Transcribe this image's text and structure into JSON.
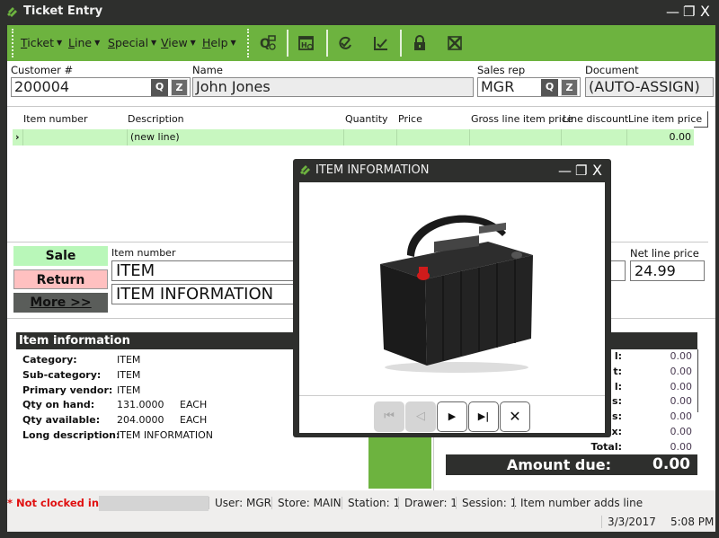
{
  "window": {
    "title": "Ticket Entry",
    "controls": {
      "minimize": "—",
      "restore": "❐",
      "close": "X"
    }
  },
  "menubar": {
    "items": [
      {
        "label": "Ticket",
        "accel": "T",
        "rest": "icket"
      },
      {
        "label": "Line",
        "accel": "L",
        "rest": "ine"
      },
      {
        "label": "Special",
        "accel": "S",
        "rest": "pecial"
      },
      {
        "label": "View",
        "accel": "V",
        "rest": "iew"
      },
      {
        "label": "Help",
        "accel": "H",
        "rest": "elp"
      }
    ],
    "caret": "▼"
  },
  "toolbar": {
    "icons": [
      "quantity-icon",
      "hold-icon",
      "verify-icon",
      "checkmark-icon",
      "lock-icon",
      "void-icon"
    ]
  },
  "header": {
    "customer_label": "Customer #",
    "customer_value": "200004",
    "name_label": "Name",
    "name_value": "John Jones",
    "salesrep_label": "Sales rep",
    "salesrep_value": "MGR",
    "document_label": "Document",
    "document_value": "(AUTO-ASSIGN)",
    "search_glyph": "Q",
    "zoom_glyph": "Z"
  },
  "grid": {
    "columns": [
      "Item number",
      "Description",
      "Quantity",
      "Price",
      "Gross line item price",
      "Line discount",
      "Line item price"
    ],
    "rows": [
      {
        "marker": "›",
        "item_number": "",
        "description": "(new line)",
        "quantity": "",
        "price": "",
        "gross": "",
        "discount": "",
        "line_price": "0.00"
      }
    ]
  },
  "entry": {
    "sale_label": "Sale",
    "return_label": "Return",
    "more_label": "More >>",
    "item_number_label": "Item number",
    "item_number_value": "ITEM",
    "description_value": "ITEM INFORMATION",
    "net_line_price_label": "Net line price",
    "net_line_price_value": "24.99"
  },
  "item_info": {
    "title": "Item information",
    "rows": [
      {
        "label": "Category:",
        "value": "ITEM",
        "unit": ""
      },
      {
        "label": "Sub-category:",
        "value": "ITEM",
        "unit": ""
      },
      {
        "label": "Primary vendor:",
        "value": "ITEM",
        "unit": ""
      },
      {
        "label": "Qty on hand:",
        "value": "131.0000",
        "unit": "EACH"
      },
      {
        "label": "Qty available:",
        "value": "204.0000",
        "unit": "EACH"
      },
      {
        "label": "Long description:",
        "value": "ITEM INFORMATION",
        "unit": ""
      }
    ]
  },
  "totals": {
    "rows": [
      {
        "label": "l:",
        "value": "0.00"
      },
      {
        "label": "t:",
        "value": "0.00"
      },
      {
        "label": "l:",
        "value": "0.00"
      },
      {
        "label": "s:",
        "value": "0.00"
      },
      {
        "label": "s:",
        "value": "0.00"
      },
      {
        "label": "x:",
        "value": "0.00"
      },
      {
        "label": "Total:",
        "value": "0.00"
      }
    ],
    "amount_due_label": "Amount due:",
    "amount_due_value": "0.00"
  },
  "dialog": {
    "title": "ITEM INFORMATION",
    "image_alt": "car battery",
    "nav": {
      "first": "⏮",
      "prev": "◁",
      "next": "▶",
      "last": "▶|",
      "close": "✕"
    }
  },
  "statusbar": {
    "clock_status": "* Not clocked in *",
    "user": "User: MGR",
    "store": "Store: MAIN",
    "station": "Station: 1",
    "drawer": "Drawer: 1",
    "session": "Session: 1",
    "mode": "Item number adds line",
    "date": "3/3/2017",
    "time": "5:08 PM"
  },
  "colors": {
    "accent_green": "#6db33f",
    "dark": "#2e2f2d",
    "sale_bg": "#b9f7b9",
    "return_bg": "#ffc0c0",
    "more_bg": "#5a5d5a",
    "grid_row": "#c8f7c0",
    "alert_red": "#e01010"
  }
}
